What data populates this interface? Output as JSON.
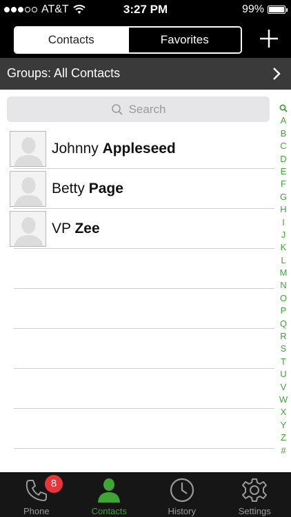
{
  "status_bar": {
    "carrier": "AT&T",
    "time": "3:27 PM",
    "battery": "99%",
    "battery_level": 0.99,
    "signal_bars_filled": 3,
    "signal_bars_total": 5
  },
  "top_nav": {
    "tabs": [
      {
        "label": "Contacts",
        "active": true
      },
      {
        "label": "Favorites",
        "active": false
      }
    ],
    "add_icon": "plus-icon"
  },
  "groups": {
    "label": "Groups: All Contacts",
    "chevron_icon": "chevron-right-icon"
  },
  "search": {
    "placeholder": "Search",
    "icon": "search-icon"
  },
  "contacts": [
    {
      "first": "Johnny",
      "last": "Appleseed"
    },
    {
      "first": "Betty",
      "last": "Page"
    },
    {
      "first": "VP",
      "last": "Zee"
    }
  ],
  "index_letters": [
    "A",
    "B",
    "C",
    "D",
    "E",
    "F",
    "G",
    "H",
    "I",
    "J",
    "K",
    "L",
    "M",
    "N",
    "O",
    "P",
    "Q",
    "R",
    "S",
    "T",
    "U",
    "V",
    "W",
    "X",
    "Y",
    "Z",
    "#"
  ],
  "tab_bar": {
    "tabs": [
      {
        "label": "Phone",
        "icon": "phone-icon",
        "active": false,
        "badge": "8"
      },
      {
        "label": "Contacts",
        "icon": "person-icon",
        "active": true
      },
      {
        "label": "History",
        "icon": "clock-icon",
        "active": false
      },
      {
        "label": "Settings",
        "icon": "gear-icon",
        "active": false
      }
    ]
  },
  "colors": {
    "accent_green": "#3fa535",
    "badge_red": "#e8353a",
    "groups_bar": "#3a3a3a",
    "tab_bar_bg": "#161616"
  }
}
